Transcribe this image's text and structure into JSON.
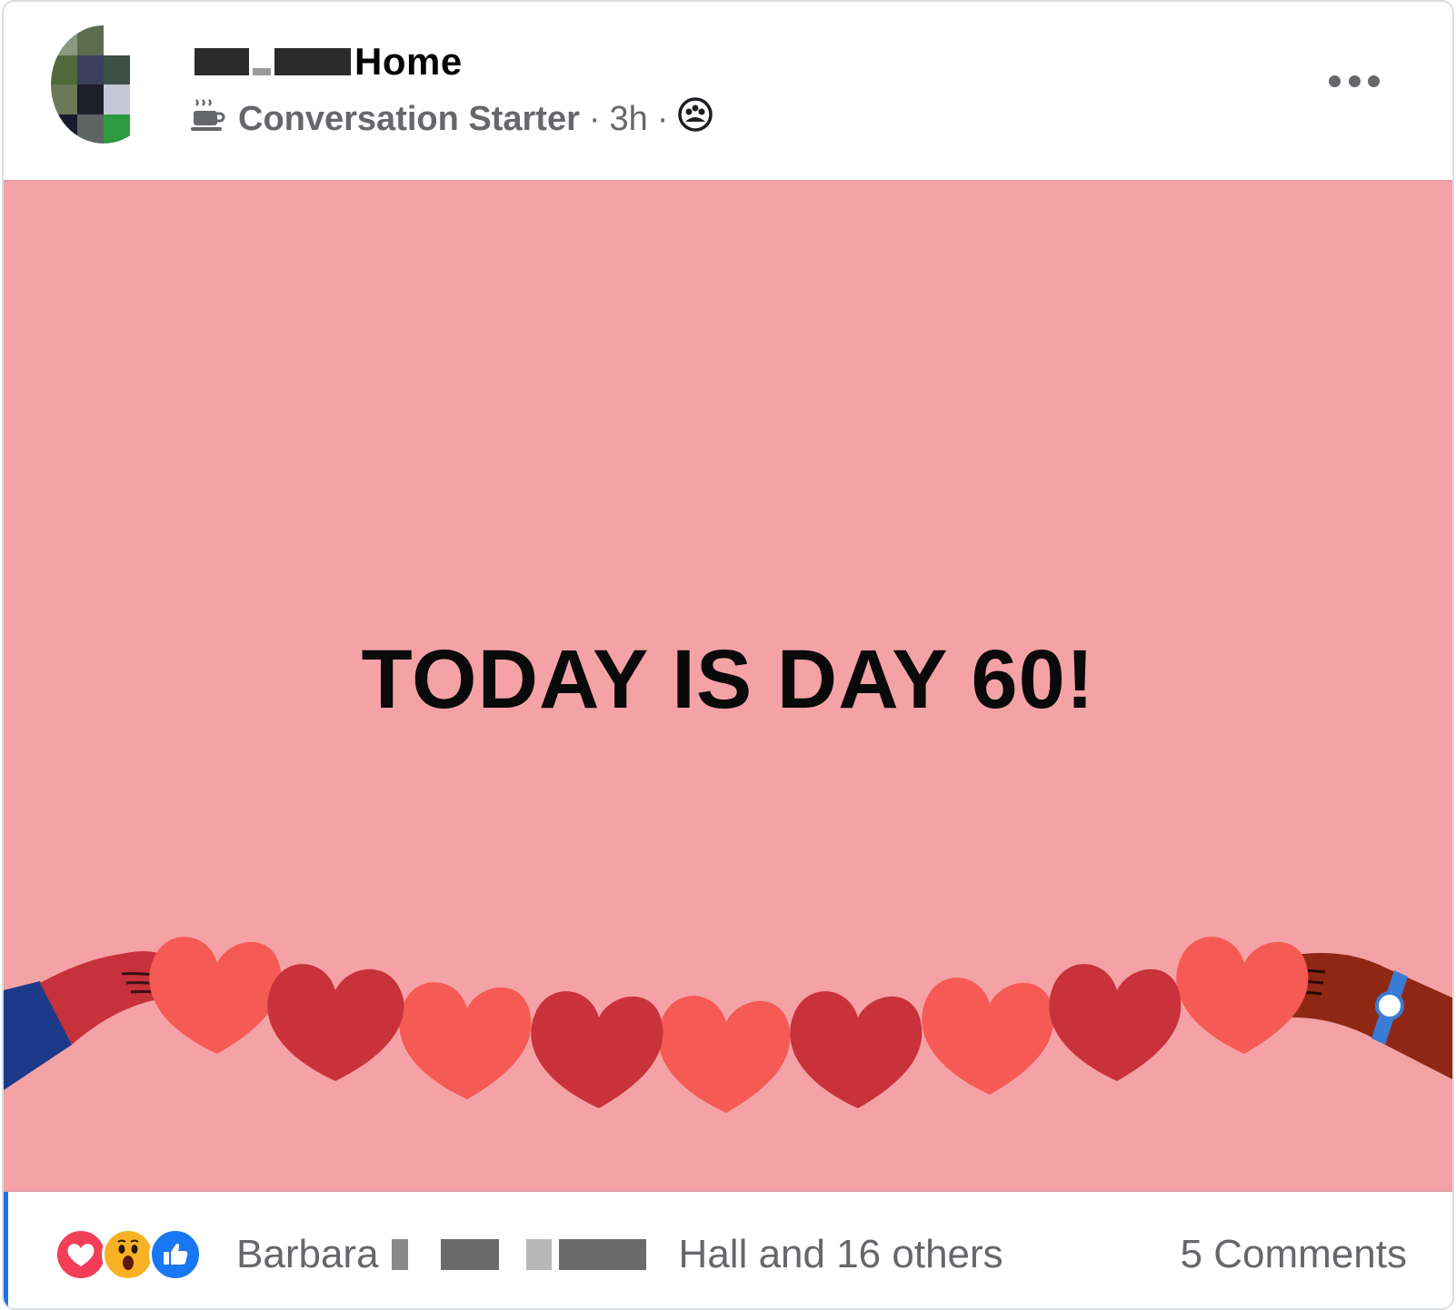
{
  "post": {
    "group_name_suffix": "Home",
    "badge_label": "Conversation Starter",
    "separator": "·",
    "time": "3h",
    "privacy_icon": "group-members-icon",
    "badge_icon": "coffee-cup-icon",
    "more_icon": "more-options-icon",
    "body_text": "TODAY IS DAY 60!",
    "background_color": "#f5a2a6"
  },
  "footer": {
    "reactions": [
      "love-reaction-icon",
      "wow-reaction-icon",
      "like-reaction-icon"
    ],
    "names_first": "Barbara",
    "names_tail": "Hall and 16 others",
    "comments": "5 Comments"
  }
}
